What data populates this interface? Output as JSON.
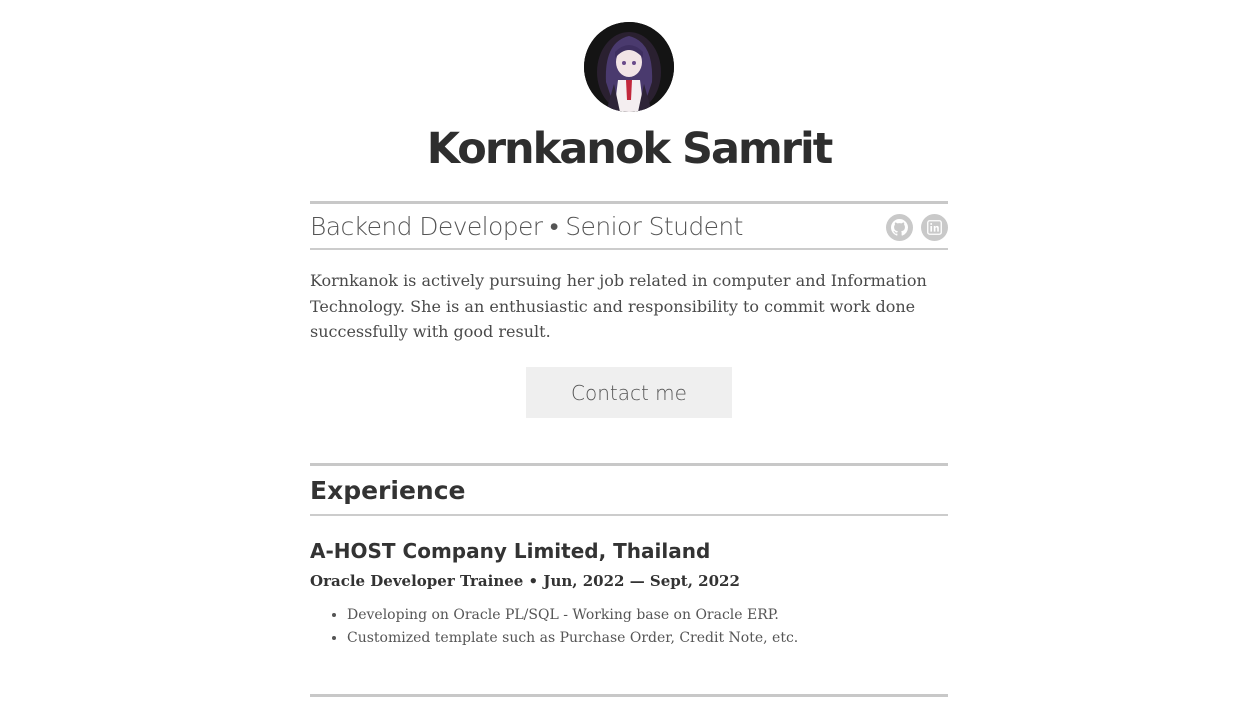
{
  "profile": {
    "name": "Kornkanok Samrit",
    "tagline": "Backend Developer • Senior Student",
    "bio": "Kornkanok is actively pursuing her job related in computer and Information Technology. She is an enthusiastic and responsibility to commit work done successfully with good result.",
    "contact_label": "Contact me",
    "social_icons": [
      "github-icon",
      "linkedin-icon"
    ]
  },
  "experience": {
    "title": "Experience",
    "jobs": [
      {
        "company": "A-HOST Company Limited, Thailand",
        "role": "Oracle Developer Trainee • Jun, 2022 — Sept, 2022",
        "bullets": [
          "Developing on Oracle PL/SQL - Working base on Oracle ERP.",
          "Customized template such as Purchase Order, Credit Note, etc."
        ]
      }
    ]
  },
  "colors": {
    "text": "#333333",
    "rule": "#c8c8c8",
    "button_bg": "#efefef",
    "icon_bg": "#c9c9c9"
  }
}
